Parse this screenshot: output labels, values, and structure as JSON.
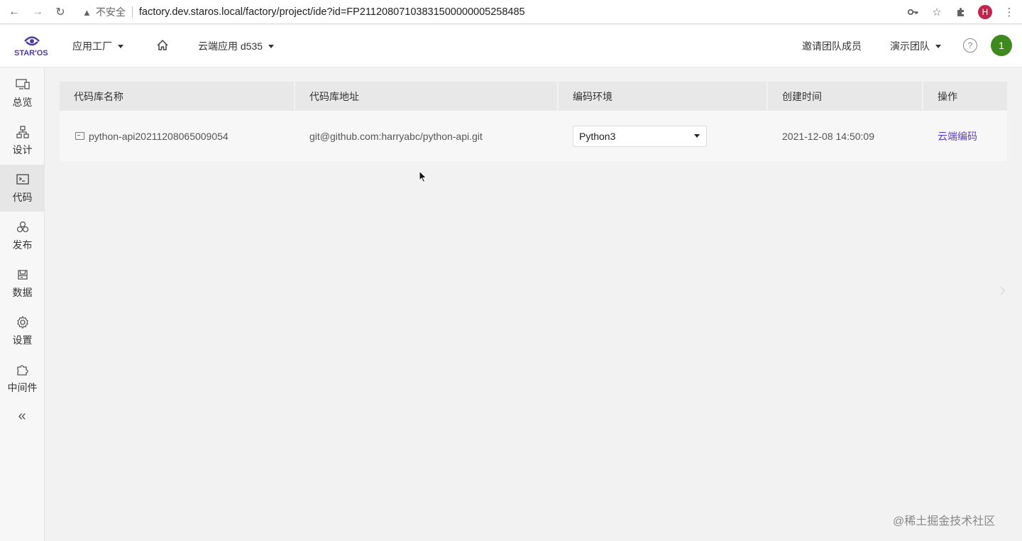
{
  "browser": {
    "security_label": "不安全",
    "url": "factory.dev.staros.local/factory/project/ide?id=FP21120807103831500000005258485",
    "profile_initial": "H"
  },
  "header": {
    "logo_text": "STAR'OS",
    "app_factory": "应用工厂",
    "project": "云端应用 d535",
    "invite": "邀请团队成员",
    "team": "演示团队",
    "avatar_initial": "1"
  },
  "sidebar": {
    "items": [
      {
        "label": "总览",
        "icon": "monitor-icon"
      },
      {
        "label": "设计",
        "icon": "sitemap-icon"
      },
      {
        "label": "代码",
        "icon": "terminal-icon"
      },
      {
        "label": "发布",
        "icon": "cluster-icon"
      },
      {
        "label": "数据",
        "icon": "database-icon"
      },
      {
        "label": "设置",
        "icon": "gear-icon"
      },
      {
        "label": "中间件",
        "icon": "puzzle-icon"
      }
    ],
    "active": "代码",
    "collapse": "«"
  },
  "table": {
    "headers": [
      "代码库名称",
      "代码库地址",
      "编码环境",
      "创建时间",
      "操作"
    ],
    "rows": [
      {
        "name": "python-api20211208065009054",
        "address": "git@github.com:harryabc/python-api.git",
        "env": "Python3",
        "created": "2021-12-08 14:50:09",
        "action": "云端编码"
      }
    ]
  },
  "watermark": "@稀土掘金技术社区",
  "colors": {
    "brand": "#4a3aa8",
    "link": "#5b3fc4",
    "avatar": "#3f8a1e",
    "profile": "#c0254b"
  }
}
